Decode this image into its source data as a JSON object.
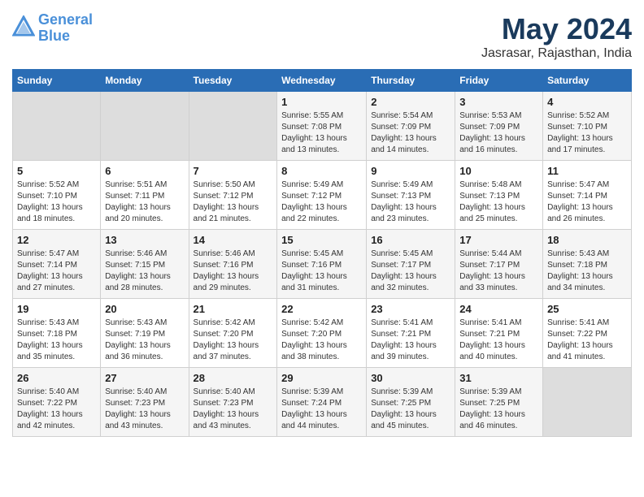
{
  "logo": {
    "line1": "General",
    "line2": "Blue"
  },
  "title": "May 2024",
  "location": "Jasrasar, Rajasthan, India",
  "days_of_week": [
    "Sunday",
    "Monday",
    "Tuesday",
    "Wednesday",
    "Thursday",
    "Friday",
    "Saturday"
  ],
  "weeks": [
    [
      {
        "day": "",
        "info": ""
      },
      {
        "day": "",
        "info": ""
      },
      {
        "day": "",
        "info": ""
      },
      {
        "day": "1",
        "info": "Sunrise: 5:55 AM\nSunset: 7:08 PM\nDaylight: 13 hours\nand 13 minutes."
      },
      {
        "day": "2",
        "info": "Sunrise: 5:54 AM\nSunset: 7:09 PM\nDaylight: 13 hours\nand 14 minutes."
      },
      {
        "day": "3",
        "info": "Sunrise: 5:53 AM\nSunset: 7:09 PM\nDaylight: 13 hours\nand 16 minutes."
      },
      {
        "day": "4",
        "info": "Sunrise: 5:52 AM\nSunset: 7:10 PM\nDaylight: 13 hours\nand 17 minutes."
      }
    ],
    [
      {
        "day": "5",
        "info": "Sunrise: 5:52 AM\nSunset: 7:10 PM\nDaylight: 13 hours\nand 18 minutes."
      },
      {
        "day": "6",
        "info": "Sunrise: 5:51 AM\nSunset: 7:11 PM\nDaylight: 13 hours\nand 20 minutes."
      },
      {
        "day": "7",
        "info": "Sunrise: 5:50 AM\nSunset: 7:12 PM\nDaylight: 13 hours\nand 21 minutes."
      },
      {
        "day": "8",
        "info": "Sunrise: 5:49 AM\nSunset: 7:12 PM\nDaylight: 13 hours\nand 22 minutes."
      },
      {
        "day": "9",
        "info": "Sunrise: 5:49 AM\nSunset: 7:13 PM\nDaylight: 13 hours\nand 23 minutes."
      },
      {
        "day": "10",
        "info": "Sunrise: 5:48 AM\nSunset: 7:13 PM\nDaylight: 13 hours\nand 25 minutes."
      },
      {
        "day": "11",
        "info": "Sunrise: 5:47 AM\nSunset: 7:14 PM\nDaylight: 13 hours\nand 26 minutes."
      }
    ],
    [
      {
        "day": "12",
        "info": "Sunrise: 5:47 AM\nSunset: 7:14 PM\nDaylight: 13 hours\nand 27 minutes."
      },
      {
        "day": "13",
        "info": "Sunrise: 5:46 AM\nSunset: 7:15 PM\nDaylight: 13 hours\nand 28 minutes."
      },
      {
        "day": "14",
        "info": "Sunrise: 5:46 AM\nSunset: 7:16 PM\nDaylight: 13 hours\nand 29 minutes."
      },
      {
        "day": "15",
        "info": "Sunrise: 5:45 AM\nSunset: 7:16 PM\nDaylight: 13 hours\nand 31 minutes."
      },
      {
        "day": "16",
        "info": "Sunrise: 5:45 AM\nSunset: 7:17 PM\nDaylight: 13 hours\nand 32 minutes."
      },
      {
        "day": "17",
        "info": "Sunrise: 5:44 AM\nSunset: 7:17 PM\nDaylight: 13 hours\nand 33 minutes."
      },
      {
        "day": "18",
        "info": "Sunrise: 5:43 AM\nSunset: 7:18 PM\nDaylight: 13 hours\nand 34 minutes."
      }
    ],
    [
      {
        "day": "19",
        "info": "Sunrise: 5:43 AM\nSunset: 7:18 PM\nDaylight: 13 hours\nand 35 minutes."
      },
      {
        "day": "20",
        "info": "Sunrise: 5:43 AM\nSunset: 7:19 PM\nDaylight: 13 hours\nand 36 minutes."
      },
      {
        "day": "21",
        "info": "Sunrise: 5:42 AM\nSunset: 7:20 PM\nDaylight: 13 hours\nand 37 minutes."
      },
      {
        "day": "22",
        "info": "Sunrise: 5:42 AM\nSunset: 7:20 PM\nDaylight: 13 hours\nand 38 minutes."
      },
      {
        "day": "23",
        "info": "Sunrise: 5:41 AM\nSunset: 7:21 PM\nDaylight: 13 hours\nand 39 minutes."
      },
      {
        "day": "24",
        "info": "Sunrise: 5:41 AM\nSunset: 7:21 PM\nDaylight: 13 hours\nand 40 minutes."
      },
      {
        "day": "25",
        "info": "Sunrise: 5:41 AM\nSunset: 7:22 PM\nDaylight: 13 hours\nand 41 minutes."
      }
    ],
    [
      {
        "day": "26",
        "info": "Sunrise: 5:40 AM\nSunset: 7:22 PM\nDaylight: 13 hours\nand 42 minutes."
      },
      {
        "day": "27",
        "info": "Sunrise: 5:40 AM\nSunset: 7:23 PM\nDaylight: 13 hours\nand 43 minutes."
      },
      {
        "day": "28",
        "info": "Sunrise: 5:40 AM\nSunset: 7:23 PM\nDaylight: 13 hours\nand 43 minutes."
      },
      {
        "day": "29",
        "info": "Sunrise: 5:39 AM\nSunset: 7:24 PM\nDaylight: 13 hours\nand 44 minutes."
      },
      {
        "day": "30",
        "info": "Sunrise: 5:39 AM\nSunset: 7:25 PM\nDaylight: 13 hours\nand 45 minutes."
      },
      {
        "day": "31",
        "info": "Sunrise: 5:39 AM\nSunset: 7:25 PM\nDaylight: 13 hours\nand 46 minutes."
      },
      {
        "day": "",
        "info": ""
      }
    ]
  ]
}
